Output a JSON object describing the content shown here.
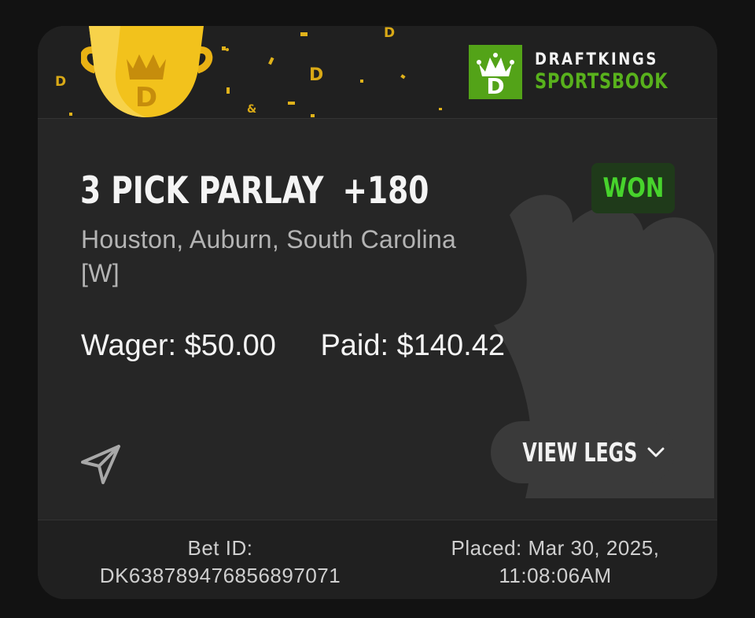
{
  "brand": {
    "line1": "DRAFTKINGS",
    "line2": "SPORTSBOOK",
    "logo_icon": "draftkings-crown-d-logo"
  },
  "banner": {
    "trophy_icon": "trophy-icon",
    "accent_color": "#f2c21c"
  },
  "bet": {
    "title": "3 PICK PARLAY",
    "odds": "+180",
    "status": "WON",
    "teams": "Houston, Auburn, South Carolina",
    "result_tag": "[W]",
    "wager_label": "Wager:",
    "wager_value": "$50.00",
    "paid_label": "Paid:",
    "paid_value": "$140.42"
  },
  "actions": {
    "share_icon": "paper-plane-icon",
    "view_legs_label": "VIEW LEGS",
    "view_legs_icon": "chevron-down-icon"
  },
  "footer": {
    "bet_id_label": "Bet ID:",
    "bet_id_value": "DK638789476856897071",
    "placed_label": "Placed: Mar 30, 2025,",
    "placed_time": "11:08:06AM"
  },
  "colors": {
    "won_green": "#47d32c",
    "brand_green": "#53a318",
    "card_bg": "#262626"
  }
}
